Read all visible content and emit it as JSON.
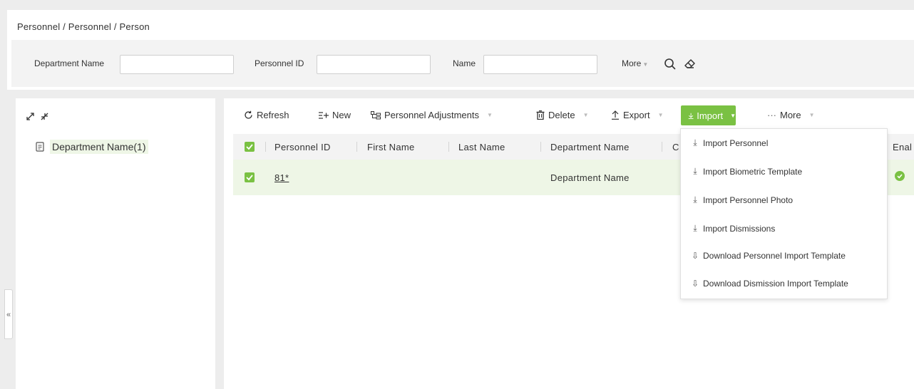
{
  "breadcrumb": "Personnel / Personnel / Person",
  "filters": {
    "department_label": "Department Name",
    "department_value": "",
    "personnel_id_label": "Personnel ID",
    "personnel_id_value": "",
    "name_label": "Name",
    "name_value": "",
    "more_label": "More"
  },
  "tree": {
    "root_label": "Department Name(1)"
  },
  "collapse_glyph": "«",
  "toolbar": {
    "refresh": "Refresh",
    "new": "New",
    "adjustments": "Personnel Adjustments",
    "delete": "Delete",
    "export": "Export",
    "import": "Import",
    "more": "More"
  },
  "table": {
    "columns": [
      "Personnel ID",
      "First Name",
      "Last Name",
      "Department Name",
      "C",
      "Enal"
    ],
    "rows": [
      {
        "personnel_id": "81*",
        "first_name": "",
        "last_name": "",
        "department": "Department Name",
        "enabled": "ok"
      }
    ]
  },
  "import_menu": {
    "items": [
      {
        "label": "Import Personnel",
        "icon": "import-icon"
      },
      {
        "label": "Import Biometric Template",
        "icon": "import-icon"
      },
      {
        "label": "Import Personnel Photo",
        "icon": "import-icon"
      },
      {
        "label": "Import Dismissions",
        "icon": "import-icon"
      },
      {
        "label": "Download Personnel Import Template",
        "icon": "download-icon"
      },
      {
        "label": "Download Dismission Import Template",
        "icon": "download-icon"
      }
    ]
  },
  "colors": {
    "accent_green": "#7ac143",
    "selected_row": "#eef6e6",
    "header_bg": "#f3f3f3"
  }
}
